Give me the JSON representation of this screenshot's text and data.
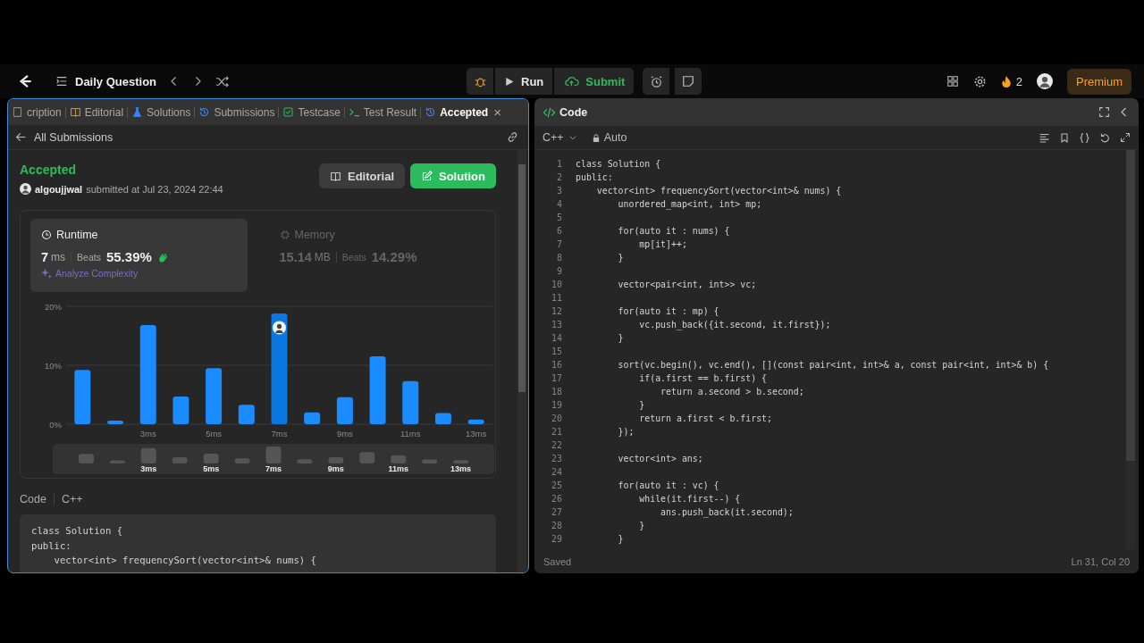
{
  "nav": {
    "title": "Daily Question",
    "run": "Run",
    "submit": "Submit",
    "streak": "2",
    "premium": "Premium"
  },
  "left_panel": {
    "tabs": [
      {
        "label": "cription",
        "kind": "description",
        "selected": false
      },
      {
        "label": "Editorial",
        "kind": "editorial",
        "selected": false
      },
      {
        "label": "Solutions",
        "kind": "solutions",
        "selected": false
      },
      {
        "label": "Submissions",
        "kind": "submissions",
        "selected": false
      },
      {
        "label": "Testcase",
        "kind": "testcase",
        "selected": false
      },
      {
        "label": "Test Result",
        "kind": "result",
        "selected": false
      },
      {
        "label": "Accepted",
        "kind": "submissions",
        "selected": true,
        "close": "×"
      }
    ],
    "back_link": "All Submissions",
    "submission": {
      "status": "Accepted",
      "user": "algoujjwal",
      "submitted": "submitted at Jul 23, 2024 22:44",
      "buttons": [
        {
          "label": "Editorial",
          "kind": "editorial"
        },
        {
          "label": "Solution",
          "kind": "solution"
        }
      ]
    },
    "metrics": [
      {
        "kind": "runtime",
        "label": "Runtime",
        "value": "7",
        "unit": "ms",
        "beats_label": "Beats",
        "beats": "55.39%",
        "selected": true,
        "link": "Analyze Complexity"
      },
      {
        "kind": "memory",
        "label": "Memory",
        "value": "15.14",
        "unit": "MB",
        "beats_label": "Beats",
        "beats": "14.29%",
        "selected": false
      }
    ],
    "chart_data": {
      "type": "bar",
      "x": [
        1,
        2,
        3,
        4,
        5,
        6,
        7,
        8,
        9,
        10,
        11,
        12,
        13
      ],
      "series": [
        {
          "color": "#1a8cff",
          "values": [
            9.2,
            0.6,
            16.8,
            4.7,
            9.5,
            3.3,
            null,
            2.0,
            4.6,
            11.5,
            7.3,
            1.9,
            0.8
          ]
        },
        {
          "color": "#0a78e0",
          "values": [
            null,
            null,
            null,
            null,
            null,
            null,
            18.8,
            null,
            null,
            null,
            null,
            null,
            null
          ]
        }
      ],
      "xlim": [
        0.5,
        13.5
      ],
      "ylim": [
        0,
        20
      ],
      "yticks": [
        {
          "value": 0,
          "label": "0%"
        },
        {
          "value": 10,
          "label": "10%"
        },
        {
          "value": 20,
          "label": "20%"
        }
      ],
      "xticks": [
        {
          "value": 3,
          "label": "3ms"
        },
        {
          "value": 5,
          "label": "5ms"
        },
        {
          "value": 7,
          "label": "7ms"
        },
        {
          "value": 9,
          "label": "9ms"
        },
        {
          "value": 11,
          "label": "11ms"
        },
        {
          "value": 13,
          "label": "13ms"
        }
      ]
    },
    "overview_labels": [
      "3ms",
      "5ms",
      "7ms",
      "9ms",
      "11ms",
      "13ms"
    ],
    "code_label": "Code",
    "code_language": "C++",
    "code_lines": [
      "class Solution {",
      "public:",
      "    vector<int> frequencySort(vector<int>& nums) {"
    ]
  },
  "editor": {
    "title": "Code",
    "language": "C++",
    "mode": "Auto",
    "status": "Saved",
    "position": "Ln 31, Col 20",
    "lines": [
      {
        "n": "1",
        "text": "class Solution {"
      },
      {
        "n": "2",
        "text": "public:"
      },
      {
        "n": "3",
        "text": "    vector<int> frequencySort(vector<int>& nums) {"
      },
      {
        "n": "4",
        "text": "        unordered_map<int, int> mp;"
      },
      {
        "n": "5"
      },
      {
        "n": "6",
        "text": "        for(auto it : nums) {"
      },
      {
        "n": "7",
        "text": "            mp[it]++;"
      },
      {
        "n": "8",
        "text": "        }"
      },
      {
        "n": "9"
      },
      {
        "n": "10",
        "text": "        vector<pair<int, int>> vc;"
      },
      {
        "n": "11"
      },
      {
        "n": "12",
        "text": "        for(auto it : mp) {"
      },
      {
        "n": "13",
        "text": "            vc.push_back({it.second, it.first});"
      },
      {
        "n": "14",
        "text": "        }"
      },
      {
        "n": "15"
      },
      {
        "n": "16",
        "text": "        sort(vc.begin(), vc.end(), [](const pair<int, int>& a, const pair<int, int>& b) {"
      },
      {
        "n": "17",
        "text": "            if(a.first == b.first) {"
      },
      {
        "n": "18",
        "text": "                return a.second > b.second;"
      },
      {
        "n": "19",
        "text": "            }"
      },
      {
        "n": "20",
        "text": "            return a.first < b.first;"
      },
      {
        "n": "21",
        "text": "        });"
      },
      {
        "n": "22"
      },
      {
        "n": "23",
        "text": "        vector<int> ans;"
      },
      {
        "n": "24"
      },
      {
        "n": "25",
        "text": "        for(auto it : vc) {"
      },
      {
        "n": "26",
        "text": "            while(it.first--) {"
      },
      {
        "n": "27",
        "text": "                ans.push_back(it.second);"
      },
      {
        "n": "28",
        "text": "            }"
      },
      {
        "n": "29",
        "text": "        }"
      }
    ]
  }
}
